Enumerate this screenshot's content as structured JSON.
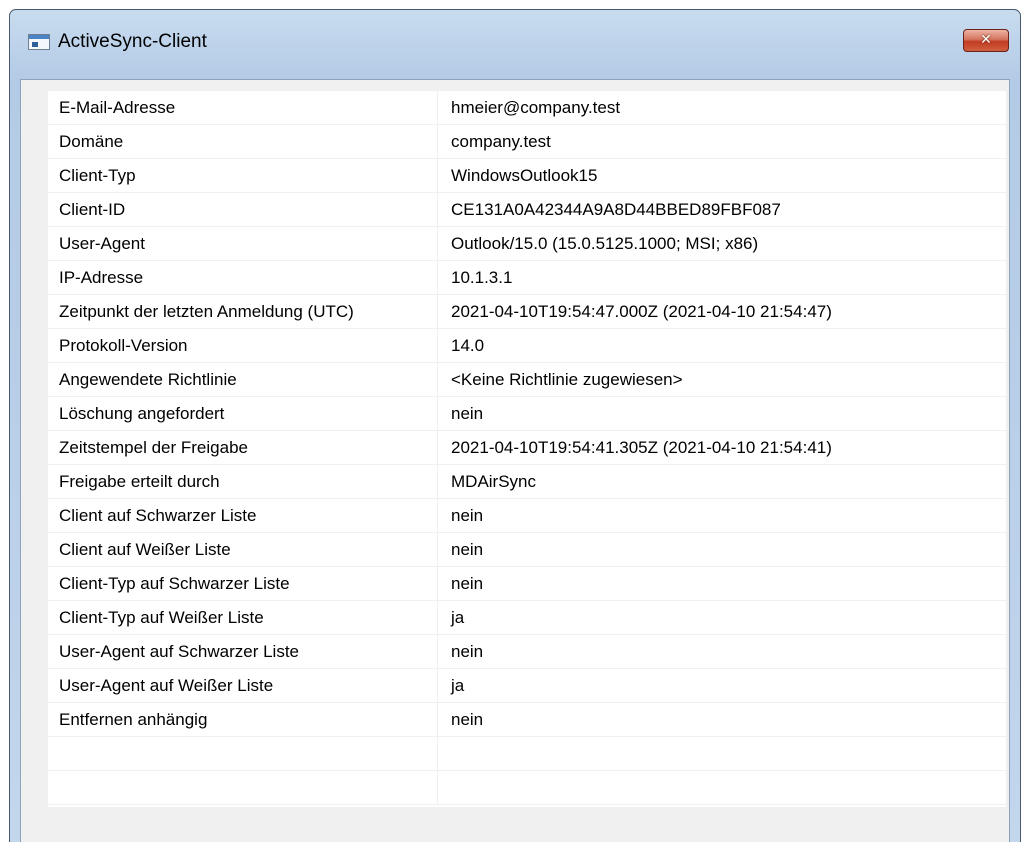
{
  "window": {
    "title": "ActiveSync-Client",
    "close_glyph": "✕",
    "icon": "window-app-icon"
  },
  "properties": [
    {
      "key": "E-Mail-Adresse",
      "value": "hmeier@company.test"
    },
    {
      "key": "Domäne",
      "value": "company.test"
    },
    {
      "key": "Client-Typ",
      "value": "WindowsOutlook15"
    },
    {
      "key": "Client-ID",
      "value": "CE131A0A42344A9A8D44BBED89FBF087"
    },
    {
      "key": "User-Agent",
      "value": "Outlook/15.0 (15.0.5125.1000; MSI; x86)"
    },
    {
      "key": "IP-Adresse",
      "value": "10.1.3.1"
    },
    {
      "key": "Zeitpunkt der letzten Anmeldung (UTC)",
      "value": "2021-04-10T19:54:47.000Z (2021-04-10 21:54:47)"
    },
    {
      "key": "Protokoll-Version",
      "value": "14.0"
    },
    {
      "key": "Angewendete Richtlinie",
      "value": "<Keine Richtlinie zugewiesen>"
    },
    {
      "key": "Löschung angefordert",
      "value": "nein"
    },
    {
      "key": "Zeitstempel der Freigabe",
      "value": "2021-04-10T19:54:41.305Z (2021-04-10 21:54:41)"
    },
    {
      "key": "Freigabe erteilt durch",
      "value": "MDAirSync"
    },
    {
      "key": "Client auf Schwarzer Liste",
      "value": "nein"
    },
    {
      "key": "Client auf Weißer Liste",
      "value": "nein"
    },
    {
      "key": "Client-Typ auf Schwarzer Liste",
      "value": "nein"
    },
    {
      "key": "Client-Typ auf Weißer Liste",
      "value": "ja"
    },
    {
      "key": "User-Agent auf Schwarzer Liste",
      "value": "nein"
    },
    {
      "key": "User-Agent auf Weißer Liste",
      "value": "ja"
    },
    {
      "key": "Entfernen anhängig",
      "value": "nein"
    },
    {
      "key": "",
      "value": ""
    },
    {
      "key": "",
      "value": ""
    }
  ]
}
